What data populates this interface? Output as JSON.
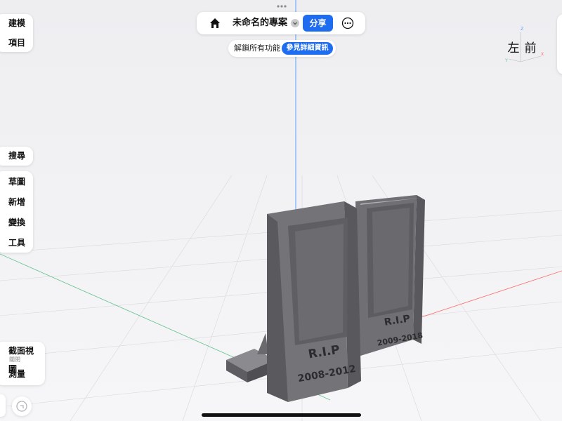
{
  "app": {
    "project_title": "未命名的專案",
    "share_label": "分享",
    "unlock_text": "解鎖所有功能",
    "details_label": "參見詳細資訊"
  },
  "sidebar": {
    "top": [
      {
        "label": "建模"
      },
      {
        "label": "項目"
      }
    ],
    "search": {
      "label": "搜尋"
    },
    "tools": [
      {
        "label": "草圖"
      },
      {
        "label": "新增"
      },
      {
        "label": "變換"
      },
      {
        "label": "工具"
      }
    ],
    "bottom": {
      "section_view": {
        "label": "截面視圖",
        "sub": "關閉"
      },
      "measure": {
        "label": "測量"
      }
    }
  },
  "viewcube": {
    "left_face": "左",
    "front_face": "前",
    "axis_z": "Z",
    "axis_x": "X",
    "axis_y": "Y"
  },
  "model": {
    "front_stone": {
      "line1": "R.I.P",
      "line2": "2008-2012"
    },
    "back_stone": {
      "line1": "R.I.P",
      "line2": "2009-2018"
    }
  },
  "colors": {
    "accent": "#1e6cf0",
    "background": "#f1f1f3",
    "axis_blue": "#5aa0ff",
    "axis_red": "#ff6b6b",
    "axis_green": "#5cc08a",
    "model_gray": "#6f6f73"
  },
  "icons": {
    "home": "home-icon",
    "chevron": "chevron-down-icon",
    "more": "more-icon",
    "drag_handle": "grabber-icon",
    "redo": "redo-icon"
  }
}
